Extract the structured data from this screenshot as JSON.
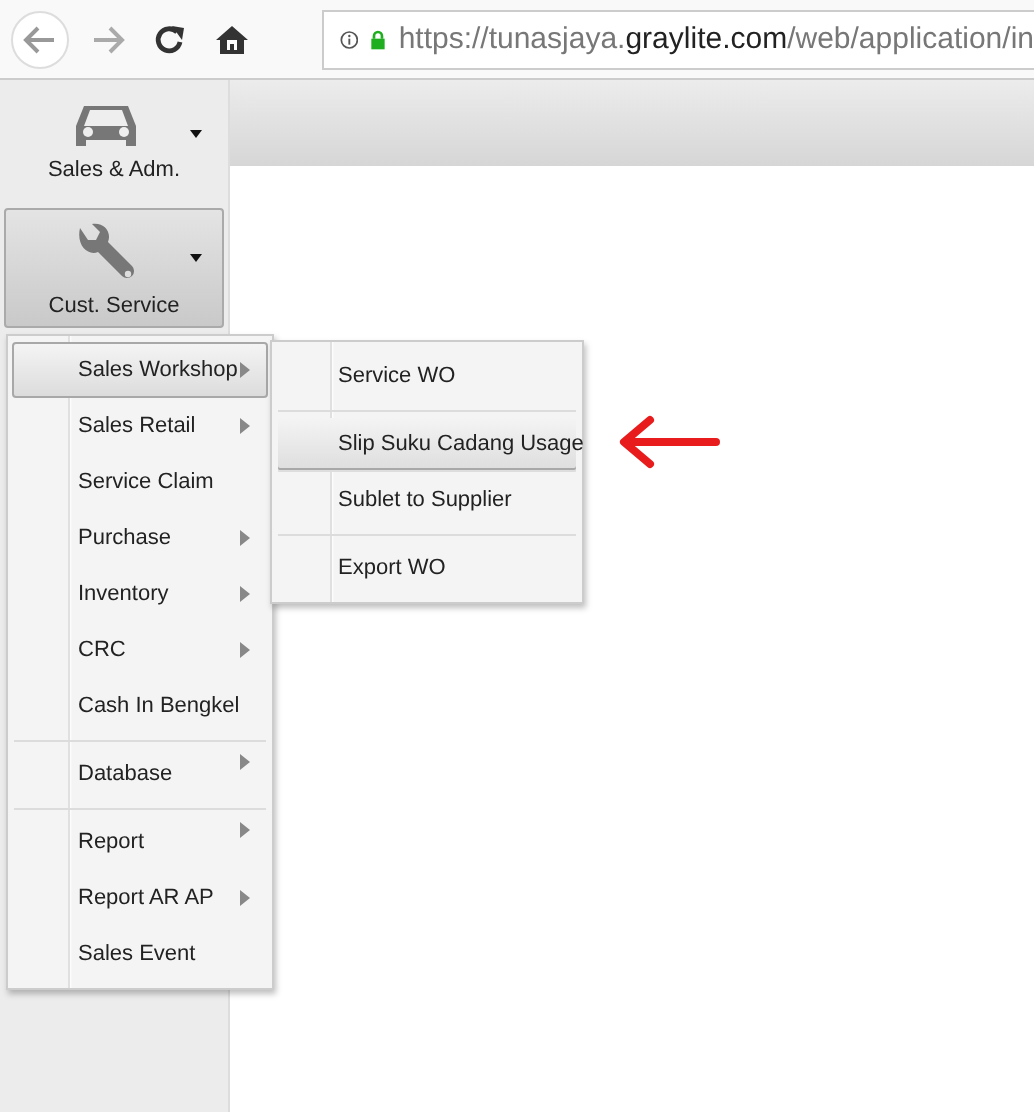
{
  "browser": {
    "url_prefix": "https://tunasjaya.",
    "url_domain": "graylite.com",
    "url_path": "/web/application/in"
  },
  "sidebar": {
    "buttons": [
      {
        "label": "Sales & Adm.",
        "kind": "car",
        "selected": false
      },
      {
        "label": "Cust. Service",
        "kind": "wrench",
        "selected": true
      }
    ]
  },
  "menu": {
    "items": [
      {
        "label": "Sales Workshop",
        "submenu": true,
        "selected": true,
        "separator_before": false
      },
      {
        "label": "Sales Retail",
        "submenu": true,
        "selected": false,
        "separator_before": false
      },
      {
        "label": "Service Claim",
        "submenu": false,
        "selected": false,
        "separator_before": false
      },
      {
        "label": "Purchase",
        "submenu": true,
        "selected": false,
        "separator_before": false
      },
      {
        "label": "Inventory",
        "submenu": true,
        "selected": false,
        "separator_before": false
      },
      {
        "label": "CRC",
        "submenu": true,
        "selected": false,
        "separator_before": false
      },
      {
        "label": "Cash In Bengkel",
        "submenu": false,
        "selected": false,
        "separator_before": false
      },
      {
        "label": "Database",
        "submenu": true,
        "selected": false,
        "separator_before": true
      },
      {
        "label": "Report",
        "submenu": true,
        "selected": false,
        "separator_before": true
      },
      {
        "label": "Report AR AP",
        "submenu": true,
        "selected": false,
        "separator_before": false
      },
      {
        "label": "Sales Event",
        "submenu": false,
        "selected": false,
        "separator_before": false
      }
    ]
  },
  "submenu": {
    "items": [
      {
        "label": "Service WO",
        "selected": false,
        "separator_before": false
      },
      {
        "label": "Slip Suku Cadang Usage",
        "selected": true,
        "separator_before": true
      },
      {
        "label": "Sublet to Supplier",
        "selected": false,
        "separator_before": false
      },
      {
        "label": "Export WO",
        "selected": false,
        "separator_before": true
      }
    ]
  }
}
